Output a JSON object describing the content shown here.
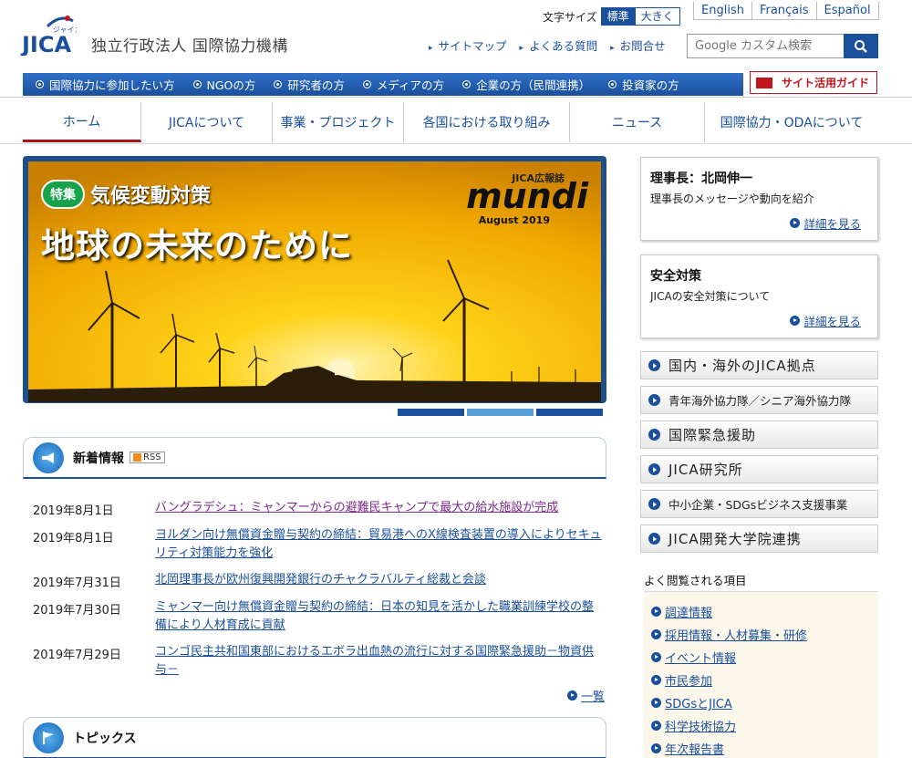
{
  "header": {
    "logo_text": "JICA",
    "logo_kana": "ジャイカ",
    "org_name": "独立行政法人 国際協力機構",
    "font_size_label": "文字サイズ",
    "font_size_standard": "標準",
    "font_size_large": "大きく",
    "languages": [
      "English",
      "Français",
      "Español"
    ],
    "util_nav": [
      "サイトマップ",
      "よくある質問",
      "お問合せ"
    ],
    "search_placeholder": "Google カスタム検索"
  },
  "audience_nav": [
    "国際協力に参加したい方",
    "NGOの方",
    "研究者の方",
    "メディアの方",
    "企業の方（民間連携）",
    "投資家の方"
  ],
  "site_guide": "サイト活用ガイド",
  "global_nav": [
    "ホーム",
    "JICAについて",
    "事業・プロジェクト",
    "各国における取り組み",
    "ニュース",
    "国際協力・ODAについて"
  ],
  "hero": {
    "tag": "特集",
    "tag_title": "気候変動対策",
    "title": "地球の未来のために",
    "magazine_sub": "JICA広報誌",
    "magazine_name": "mundi",
    "magazine_date": "August 2019"
  },
  "news": {
    "title": "新着情報",
    "rss": "RSS",
    "items": [
      {
        "date": "2019年8月1日",
        "title": "バングラデシュ：ミャンマーからの避難民キャンプで最大の給水施設が完成"
      },
      {
        "date": "2019年8月1日",
        "title": "ヨルダン向け無償資金贈与契約の締結：貿易港へのX線検査装置の導入によりセキュリティ対策能力を強化"
      },
      {
        "date": "2019年7月31日",
        "title": "北岡理事長が欧州復興開発銀行のチャクラバルティ総裁と会談"
      },
      {
        "date": "2019年7月30日",
        "title": "ミャンマー向け無償資金贈与契約の締結：日本の知見を活かした職業訓練学校の整備により人材育成に貢献"
      },
      {
        "date": "2019年7月29日",
        "title": "コンゴ民主共和国東部におけるエボラ出血熱の流行に対する国際緊急援助－物資供与－"
      }
    ],
    "more": "一覧"
  },
  "topics": {
    "title": "トピックス"
  },
  "sidebar": {
    "president": {
      "title": "理事長：北岡伸一",
      "desc": "理事長のメッセージや動向を紹介",
      "link": "詳細を見る"
    },
    "safety": {
      "title": "安全対策",
      "desc": "JICAの安全対策について",
      "link": "詳細を見る"
    },
    "buttons": [
      "国内・海外のJICA拠点",
      "青年海外協力隊／シニア海外協力隊",
      "国際緊急援助",
      "JICA研究所",
      "中小企業・SDGsビジネス支援事業",
      "JICA開発大学院連携"
    ],
    "favorites_title": "よく閲覧される項目",
    "favorites": [
      "調達情報",
      "採用情報・人材募集・研修",
      "イベント情報",
      "市民参加",
      "SDGsとJICA",
      "科学技術協力",
      "年次報告書"
    ]
  },
  "colors": {
    "brand": "#1a4f9c",
    "accent_red": "#a5151a",
    "hero_sky": "#f2b600"
  }
}
